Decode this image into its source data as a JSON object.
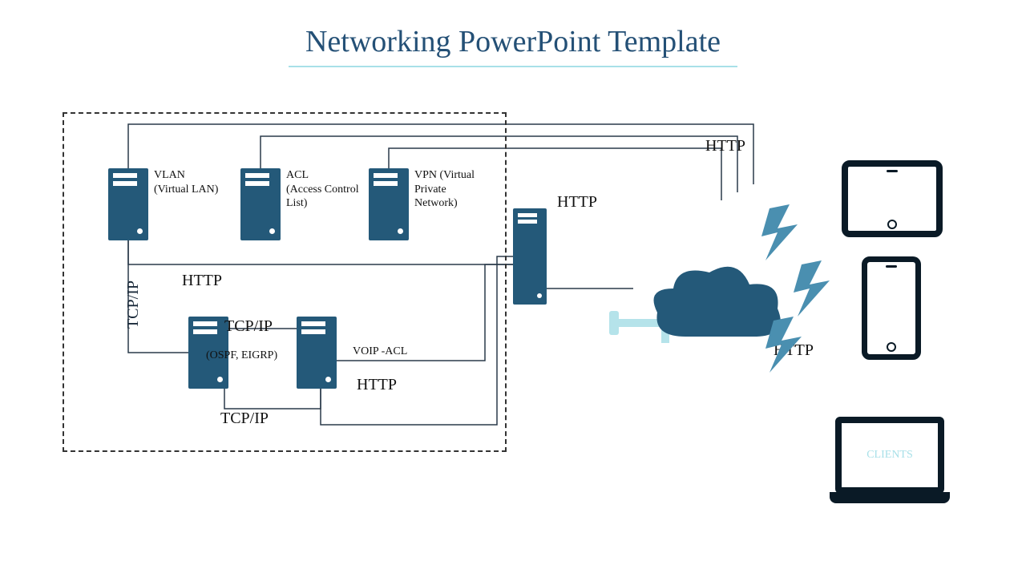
{
  "title": "Networking PowerPoint Template",
  "servers": {
    "vlan": {
      "label": "VLAN\n(Virtual LAN)"
    },
    "acl": {
      "label": "ACL\n(Access Control\nList)"
    },
    "vpn": {
      "label": "VPN (Virtual\nPrivate\nNetwork)"
    },
    "ospf": {
      "label": "(OSPF, EIGRP)"
    },
    "voip": {
      "label": "VOIP -ACL"
    }
  },
  "protocols": {
    "http_top_right": "HTTP",
    "http_right": "HTTP",
    "http_clients": "HTTP",
    "http_mid": "HTTP",
    "http_btm": "HTTP",
    "tcpip_vert": "TCP/IP",
    "tcpip_top": "TCP/IP",
    "tcpip_btm": "TCP/IP"
  },
  "client_label": "CLIENTS"
}
